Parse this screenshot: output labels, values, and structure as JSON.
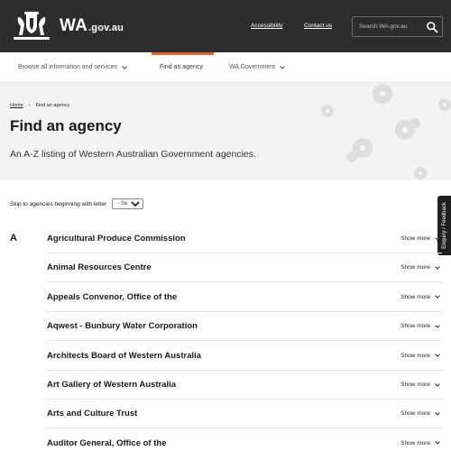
{
  "header": {
    "logo_main": "WA",
    "logo_sub": ".gov.au",
    "links": [
      "Accessibility",
      "Contact us"
    ],
    "search_placeholder": "Search WA.gov.au"
  },
  "nav": {
    "items": [
      {
        "label": "Browse all information and services",
        "has_dropdown": true
      },
      {
        "label": "Find an agency",
        "active": true
      },
      {
        "label": "WA Government",
        "has_dropdown": true
      }
    ]
  },
  "breadcrumb": {
    "home": "Home",
    "separator": "›",
    "current": "Find an agency"
  },
  "page": {
    "title": "Find an agency",
    "subtitle": "An A-Z listing of Western Australian Government agencies."
  },
  "skip": {
    "label": "Skip to agencies beginning with letter",
    "selected": "- Select -"
  },
  "feedback": {
    "label": "Enquiry / Feedback"
  },
  "list": {
    "letter": "A",
    "show_more_label": "Show more",
    "agencies": [
      "Agricultural Produce Commission",
      "Animal Resources Centre",
      "Appeals Convenor, Office of the",
      "Aqwest - Bunbury Water Corporation",
      "Architects Board of Western Australia",
      "Art Gallery of Western Australia",
      "Arts and Culture Trust",
      "Auditor General, Office of the"
    ]
  },
  "colors": {
    "header_bg": "#2d2d2d",
    "accent": "#d9652f",
    "hero_bg": "#f3f3f3"
  }
}
